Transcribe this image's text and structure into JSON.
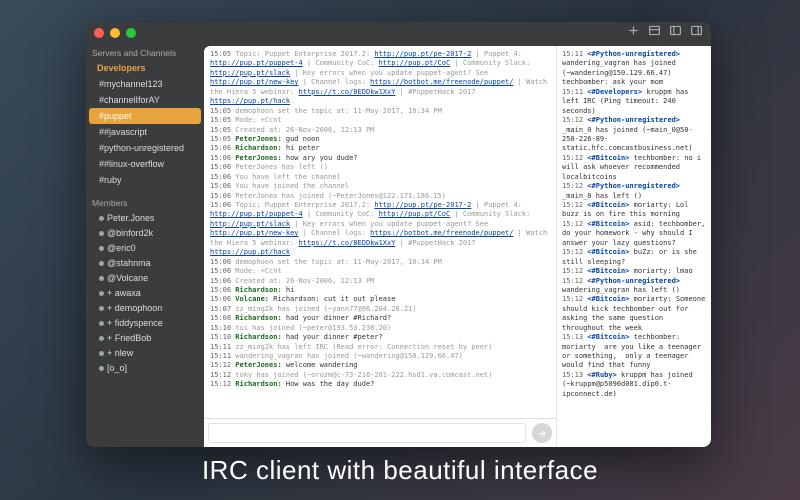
{
  "caption": "IRC client with beautiful interface",
  "toolbar_icons": [
    "add",
    "list",
    "columns",
    "panels"
  ],
  "sidebar": {
    "header_servers": "Servers and Channels",
    "server": "Developers",
    "channels": [
      "#mychannel123",
      "#channelIforAY",
      "#puppet",
      "##javascript",
      "#python-unregistered",
      "##linux-overflow",
      "#ruby"
    ],
    "selected_channel": "#puppet",
    "header_members": "Members",
    "members": [
      "Peter.Jones",
      "@binford2k",
      "@eric0",
      "@stahnma",
      "@Volcane",
      "+ awaxa",
      "+ demophoon",
      "+ fiddyspence",
      "+ FriedBob",
      "+ nlew",
      "[o_o]"
    ]
  },
  "main_log": [
    {
      "t": "15:05",
      "style": "sys",
      "text": "Topic: Puppet Enterprise 2017.2: http://pup.pt/pe-2017-2 | Puppet 4: http://pup.pt/puppet-4 | Community CoC: http://pup.pt/CoC | Community Slack: http://pup.pt/slack | Key errors when you update puppet-agent? See http://pup.pt/new-key | Channel logs: https://botbot.me/freenode/puppet/ | Watch the Hiera 5 webinar: https://t.co/8EDDkw1XxY | #PuppetHack 2017 https://pup.pt/hack"
    },
    {
      "t": "15:05",
      "style": "sys",
      "text": "demophoon set the topic at: 11-May-2017, 10:34 PM"
    },
    {
      "t": "15:05",
      "style": "sys",
      "text": "Mode: +Ccnt"
    },
    {
      "t": "15:05",
      "style": "sys",
      "text": "Created at: 26-Nov-2006, 12:13 PM"
    },
    {
      "t": "15:05",
      "nick": "PeterJones",
      "text": "gud noon"
    },
    {
      "t": "15:06",
      "nick": "Richardson",
      "text": "hi peter"
    },
    {
      "t": "15:06",
      "nick": "PeterJones",
      "text": "how ary you dude?"
    },
    {
      "t": "15:06",
      "style": "sys",
      "text": "PeterJones has left ()"
    },
    {
      "t": "15:06",
      "style": "sys",
      "text": "You have left the channel"
    },
    {
      "t": "15:06",
      "style": "sys",
      "text": "You have joined the channel"
    },
    {
      "t": "15:06",
      "style": "sys",
      "text": "PeterJones has joined (~PeterJones@122.171.186.15)"
    },
    {
      "t": "15:06",
      "style": "sys",
      "text": "Topic: Puppet Enterprise 2017.2: http://pup.pt/pe-2017-2 | Puppet 4: http://pup.pt/puppet-4 | Community CoC: http://pup.pt/CoC | Community Slack: http://pup.pt/slack | Key errors when you update puppet-agent? See http://pup.pt/new-key | Channel logs: https://botbot.me/freenode/puppet/ | Watch the Hiera 5 webinar: https://t.co/8EDDkw1XxY | #PuppetHack 2017 https://pup.pt/hack"
    },
    {
      "t": "15:06",
      "style": "sys",
      "text": "demophoon set the topic at: 11-May-2017, 10:34 PM"
    },
    {
      "t": "15:06",
      "style": "sys",
      "text": "Mode: +Ccnt"
    },
    {
      "t": "15:06",
      "style": "sys",
      "text": "Created at: 26-Nov-2006, 12:13 PM"
    },
    {
      "t": "15:06",
      "nick": "Richardson",
      "text": "hi"
    },
    {
      "t": "15:06",
      "nick": "Volcane",
      "text": "Richardson: cut it out please"
    },
    {
      "t": "15:07",
      "style": "sys",
      "text": "zz_ming2k has joined (~yann77@96.204.26.21)"
    },
    {
      "t": "15:08",
      "nick": "Richardson",
      "text": "had your dinner #Richard?"
    },
    {
      "t": "15:10",
      "style": "sys",
      "text": "tui has joined (~peter@193.53.238.20)"
    },
    {
      "t": "15:10",
      "nick": "Richardson",
      "text": "had your dinner #peter?"
    },
    {
      "t": "15:11",
      "style": "sys",
      "text": "zz_ming2k has left IRC (Read error: Connection reset by peer)"
    },
    {
      "t": "15:11",
      "style": "sys",
      "text": "wandering_vagran has joined (~wandering@150.129.66.47)"
    },
    {
      "t": "15:12",
      "nick": "PeterJones",
      "text": "welcome wandering"
    },
    {
      "t": "15:12",
      "style": "sys",
      "text": "toky has joined (~oruzm@c-73-216-201-222.hsd1.va.comcast.net)"
    },
    {
      "t": "15:12",
      "nick": "Richardson",
      "text": "How was the day dude?"
    }
  ],
  "aside_log": [
    {
      "t": "15:11",
      "chan": "#Python-unregistered",
      "text": "wandering_vagran has joined (~wandering@150.129.66.47)"
    },
    {
      "t": "",
      "chan": "",
      "text": "techbomber: ask your mom"
    },
    {
      "t": "15:11",
      "chan": "#Developers",
      "text": "kruppm has left IRC (Ping timeout: 240 seconds)"
    },
    {
      "t": "15:12",
      "chan": "#Python-unregistered",
      "text": "_main_0 has joined (~main_0@50-250-226-89-static.hfc.comcastbusiness.net)"
    },
    {
      "t": "15:12",
      "chan": "#Bitcoin",
      "text": "techbomber: no i will ask whoever recommended localbitcoins"
    },
    {
      "t": "15:12",
      "chan": "#Python-unregistered",
      "text": "_main_0 has left ()"
    },
    {
      "t": "15:12",
      "chan": "#Bitcoin",
      "text": "moriarty: Lol buzz is on fire this morning"
    },
    {
      "t": "15:12",
      "chan": "#Bitcoin",
      "text": "asid: techbomber, do your homework - why should I answer your lazy questions?"
    },
    {
      "t": "15:12",
      "chan": "#Bitcoin",
      "text": "buZz: or is she still sleeping?"
    },
    {
      "t": "15:12",
      "chan": "#Bitcoin",
      "text": "moriarty: lmao"
    },
    {
      "t": "15:12",
      "chan": "#Python-unregistered",
      "text": "wandering_vagran has left ()"
    },
    {
      "t": "15:12",
      "chan": "#Bitcoin",
      "text": "moriarty: Someone should kick techbomber out for asking the same question throughout the week"
    },
    {
      "t": "15:13",
      "chan": "#Bitcoin",
      "text": "techbomber: moriarty  are you like a teenager or something,  only a teenager would find that funny"
    },
    {
      "t": "15:13",
      "chan": "#Ruby",
      "text": "kruppm has joined (~kruppm@p5090d081.dip0.t-ipconnect.de)"
    }
  ],
  "input": {
    "value": "",
    "placeholder": ""
  }
}
